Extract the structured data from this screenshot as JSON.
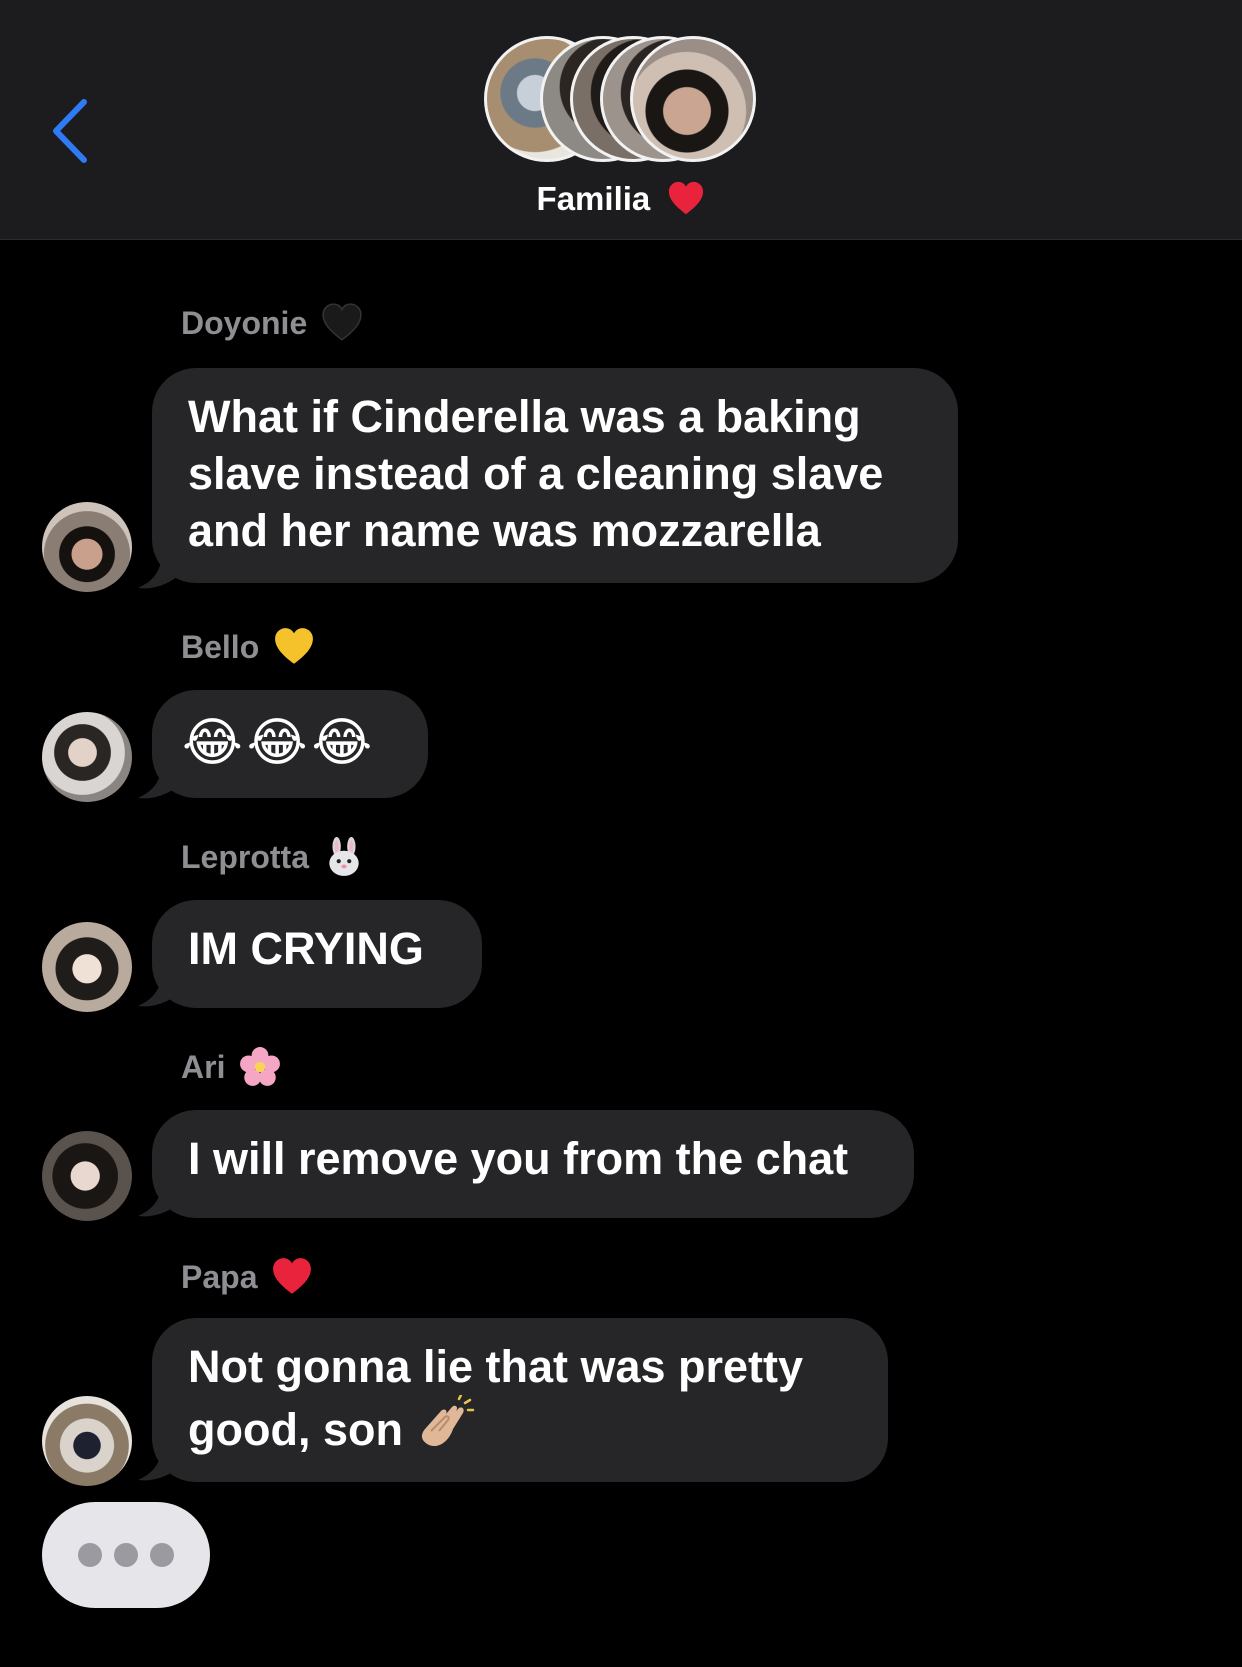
{
  "header": {
    "back_icon": "chevron-left-icon",
    "group_name": "Familia",
    "group_emoji": "red-heart-icon",
    "accent_color": "#2f7bf6"
  },
  "messages": [
    {
      "sender": "Doyonie",
      "sender_emoji": "black-heart-icon",
      "text": "What if Cinderella was a baking slave instead of a cleaning slave and her name was mozzarella"
    },
    {
      "sender": "Bello",
      "sender_emoji": "yellow-heart-icon",
      "text": "😂😂😂"
    },
    {
      "sender": "Leprotta",
      "sender_emoji": "rabbit-face-icon",
      "text": "IM CRYING"
    },
    {
      "sender": "Ari",
      "sender_emoji": "cherry-blossom-icon",
      "text": "I will remove you from the chat"
    },
    {
      "sender": "Papa",
      "sender_emoji": "red-heart-icon",
      "text": "Not gonna lie that was pretty good, son",
      "trailing_emoji": "clapping-hands-icon"
    }
  ],
  "colors": {
    "bubble_bg": "#262628",
    "sender_text": "#8e8e93",
    "header_bg": "#1c1c1e",
    "typing_bg": "#e5e5ea"
  }
}
